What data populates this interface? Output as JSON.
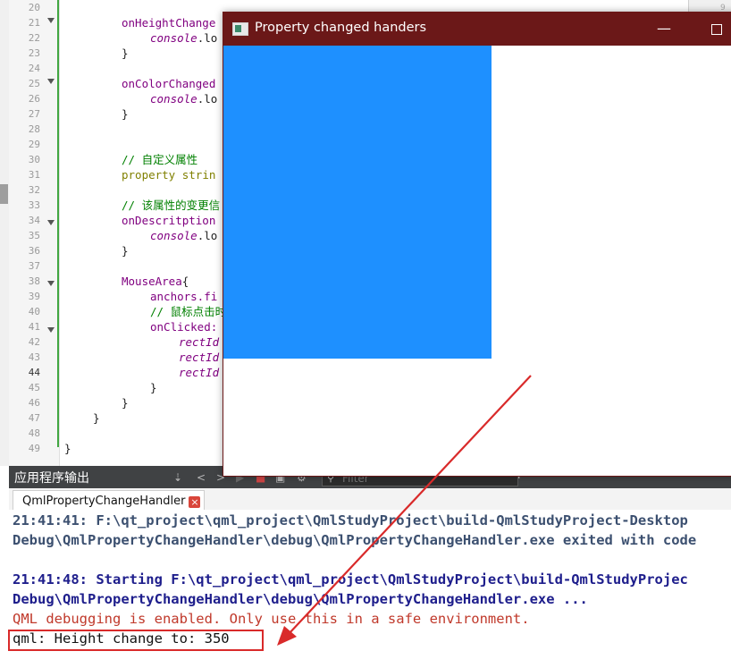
{
  "editor": {
    "line_numbers": [
      "20",
      "21",
      "22",
      "23",
      "24",
      "25",
      "26",
      "27",
      "28",
      "29",
      "30",
      "31",
      "32",
      "33",
      "34",
      "35",
      "36",
      "37",
      "38",
      "39",
      "40",
      "41",
      "42",
      "43",
      "44",
      "45",
      "46",
      "47",
      "48",
      "49"
    ],
    "fold_markers_at_lines": [
      "21",
      "25",
      "34",
      "38",
      "41"
    ],
    "code": {
      "l21": "onHeightChange",
      "l22_obj": "console",
      "l22_rest": ".lo",
      "l23": "}",
      "l25": "onColorChanged",
      "l26_obj": "console",
      "l26_rest": ".lo",
      "l27": "}",
      "l30": "// 自定义属性",
      "l31_kw": "property",
      "l31_rest": " strin",
      "l33": "// 该属性的变更信",
      "l34": "onDescritption",
      "l35_obj": "console",
      "l35_rest": ".lo",
      "l36": "}",
      "l38_type": "MouseArea",
      "l38_brace": "{",
      "l39": "anchors.fi",
      "l40": "// 鼠标点击时",
      "l41": "onClicked:",
      "l42": "rectId",
      "l43": "rectId",
      "l44": "rectId",
      "l45": "}",
      "l46": "}",
      "l47": "}",
      "l49": "}"
    },
    "mini_panel_number": "9"
  },
  "output_pane": {
    "title": "应用程序输出",
    "filter_placeholder": "Filter",
    "toolbar_icons": [
      "attach-icon",
      "prev-icon",
      "next-icon",
      "run-icon",
      "stop-icon",
      "debug-icon",
      "settings-icon",
      "zoom-in-icon",
      "zoom-out-icon"
    ],
    "tab_label": "QmlPropertyChangeHandler",
    "tab_close": "×",
    "lines": [
      {
        "text": "21:41:41: F:\\qt_project\\qml_project\\QmlStudyProject\\build-QmlStudyProject-Desktop",
        "style": "gray"
      },
      {
        "text": "Debug\\QmlPropertyChangeHandler\\debug\\QmlPropertyChangeHandler.exe exited with code",
        "style": "gray"
      },
      {
        "text": "",
        "style": "black"
      },
      {
        "text": "21:41:48: Starting F:\\qt_project\\qml_project\\QmlStudyProject\\build-QmlStudyProjec",
        "style": "blue"
      },
      {
        "text": "Debug\\QmlPropertyChangeHandler\\debug\\QmlPropertyChangeHandler.exe ...",
        "style": "blue"
      },
      {
        "text": "QML debugging is enabled. Only use this in a safe environment.",
        "style": "red"
      },
      {
        "text": "qml: Height change to: 350",
        "style": "black"
      }
    ]
  },
  "window": {
    "title": "Property changed handers",
    "minimize_glyph": "—",
    "titlebar_color": "#6b1818",
    "rect_color": "#1e90ff"
  },
  "annotation": {
    "color": "#d92a2a"
  }
}
